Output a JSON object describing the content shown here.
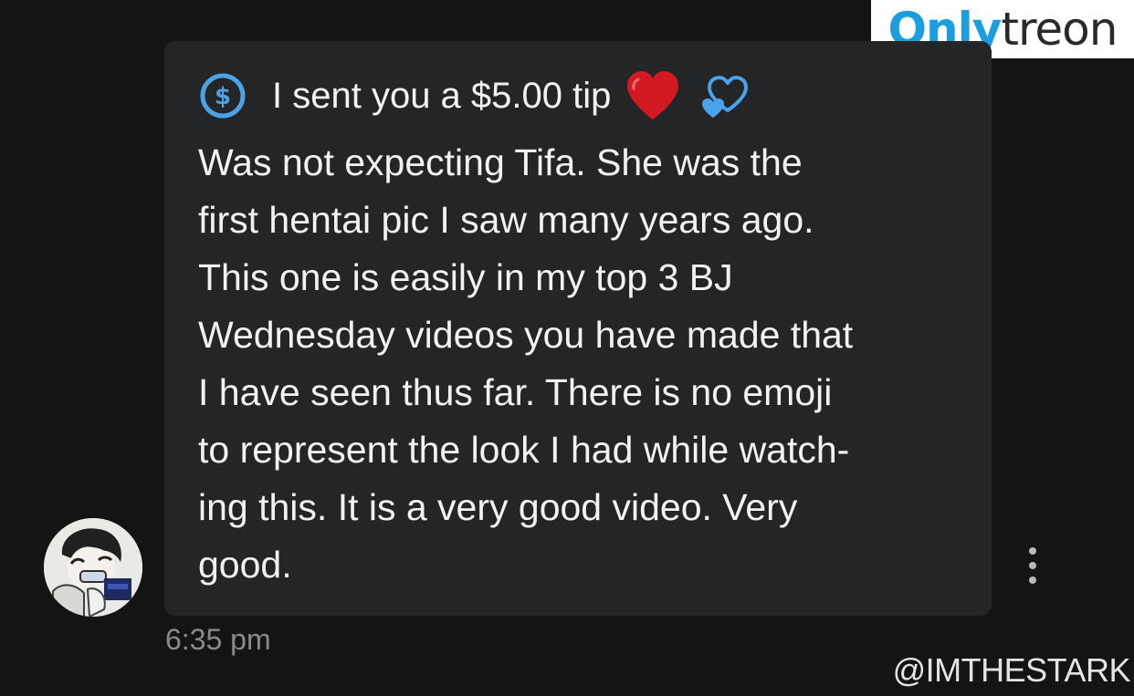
{
  "logo": {
    "part1": "Only",
    "part2": "treon"
  },
  "message": {
    "tip_label": "I sent you a $5.00 tip",
    "body": "Was not expecting Tifa. She was the\nfirst hentai pic I saw many years ago.\nThis one is easily in my top 3 BJ\nWednesday videos you have made that\nI have seen thus far. There is no emoji\nto represent the look I had while watch-\ning this. It is a very good video. Very\ngood.",
    "timestamp": "6:35 pm"
  },
  "watermark": "@IMTHESTARK",
  "icons": {
    "tip": "dollar-circle-icon",
    "heart1": "red-heart-icon",
    "heart2": "blue-hearts-icon",
    "menu": "more-vertical-icon"
  },
  "colors": {
    "background": "#141415",
    "bubble": "#232526",
    "text": "#f2f2f2",
    "accent_blue": "#4aa3e8",
    "heart_red": "#d31a22",
    "timestamp": "#8a8a8a",
    "logo_blue": "#1a9ee0"
  }
}
